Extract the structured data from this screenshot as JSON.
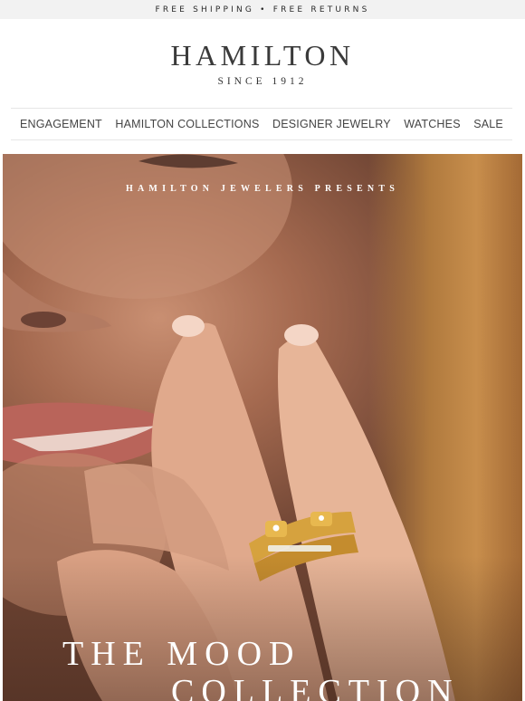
{
  "announcement": {
    "text": "FREE SHIPPING • FREE RETURNS"
  },
  "brand": {
    "name": "HAMILTON",
    "since": "SINCE 1912"
  },
  "nav": {
    "items": [
      {
        "label": "ENGAGEMENT"
      },
      {
        "label": "HAMILTON COLLECTIONS"
      },
      {
        "label": "DESIGNER JEWELRY"
      },
      {
        "label": "WATCHES"
      },
      {
        "label": "SALE"
      }
    ]
  },
  "hero": {
    "eyebrow": "HAMILTON JEWELERS PRESENTS",
    "headline_line1": "THE MOOD",
    "headline_line2": "COLLECTION",
    "image_subject": "hero-photo-hand-with-gold-rings"
  },
  "colors": {
    "announcement_bg": "#f2f2f2",
    "text_dark": "#3a3a3a",
    "ring_gold": "#d6a23e"
  }
}
